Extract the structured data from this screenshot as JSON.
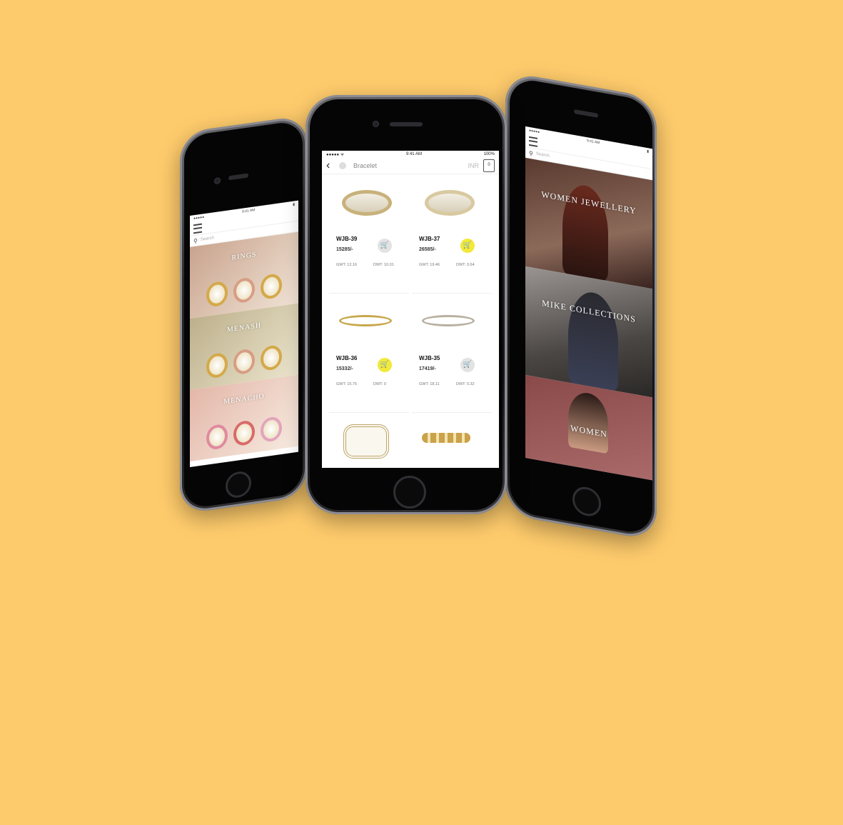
{
  "colors": {
    "background": "#fecb6c",
    "accent": "#f2e93b"
  },
  "center_screen": {
    "status": {
      "carrier": "●●●●● ᯤ",
      "time": "9:41 AM",
      "battery": "100%"
    },
    "navbar": {
      "back_icon": "chevron-left-icon",
      "title": "Bracelet",
      "right_text": "INR",
      "bag_count": "0"
    },
    "products": [
      {
        "code": "WJB-39",
        "price": "15285/-",
        "dwt_a": "GWT: 12.16",
        "dwt_b": "DWT: 10.01",
        "cart_active": false
      },
      {
        "code": "WJB-37",
        "price": "26585/-",
        "dwt_a": "GWT: 19.46",
        "dwt_b": "DWT: 0.64",
        "cart_active": true
      },
      {
        "code": "WJB-36",
        "price": "15332/-",
        "dwt_a": "GWT: 15.75",
        "dwt_b": "DWT: 0",
        "cart_active": true
      },
      {
        "code": "WJB-35",
        "price": "17419/-",
        "dwt_a": "GWT: 18.11",
        "dwt_b": "DWT: 0.32",
        "cart_active": false
      },
      {
        "code": "",
        "price": "",
        "dwt_a": "",
        "dwt_b": "",
        "cart_active": false
      },
      {
        "code": "",
        "price": "",
        "dwt_a": "",
        "dwt_b": "",
        "cart_active": false
      }
    ]
  },
  "left_screen": {
    "search_placeholder": "Search",
    "banners": [
      "RINGS",
      "MENASH",
      "MENACHO"
    ]
  },
  "right_screen": {
    "search_placeholder": "Search",
    "banners": [
      "WOMEN JEWELLERY",
      "MIKE COLLECTIONS",
      "WOMEN"
    ]
  }
}
